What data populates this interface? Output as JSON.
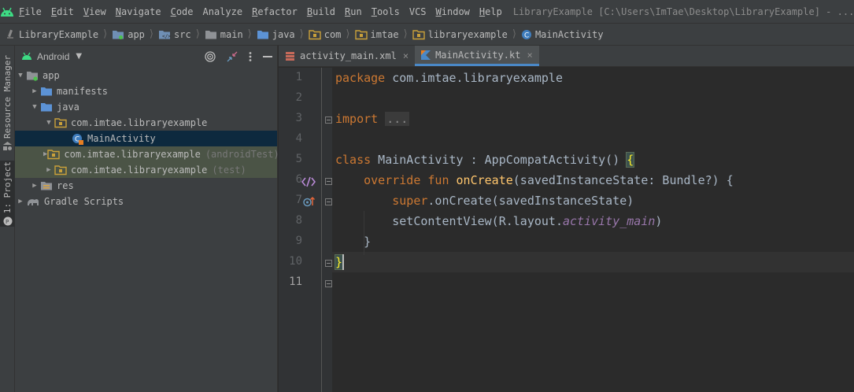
{
  "menubar": {
    "items": [
      {
        "label": "File",
        "mnemonic": "F",
        "rest": "ile"
      },
      {
        "label": "Edit",
        "mnemonic": "E",
        "rest": "dit"
      },
      {
        "label": "View",
        "mnemonic": "V",
        "rest": "iew"
      },
      {
        "label": "Navigate",
        "mnemonic": "N",
        "rest": "avigate"
      },
      {
        "label": "Code",
        "mnemonic": "C",
        "rest": "ode"
      },
      {
        "label": "Analyze",
        "mnemonic": "",
        "rest": "Analyze"
      },
      {
        "label": "Refactor",
        "mnemonic": "R",
        "rest": "efactor"
      },
      {
        "label": "Build",
        "mnemonic": "B",
        "rest": "uild"
      },
      {
        "label": "Run",
        "mnemonic": "R",
        "rest": "un"
      },
      {
        "label": "Tools",
        "mnemonic": "T",
        "rest": "ools"
      },
      {
        "label": "VCS",
        "mnemonic": "",
        "rest": "VCS"
      },
      {
        "label": "Window",
        "mnemonic": "W",
        "rest": "indow"
      },
      {
        "label": "Help",
        "mnemonic": "H",
        "rest": "elp"
      }
    ],
    "window_title": "LibraryExample [C:\\Users\\ImTae\\Desktop\\LibraryExample] - ...\\app\\src\\main\\java\\com\\"
  },
  "breadcrumb": [
    "LibraryExample",
    "app",
    "src",
    "main",
    "java",
    "com",
    "imtae",
    "libraryexample",
    "MainActivity"
  ],
  "left_strip": {
    "resource_manager": "Resource Manager",
    "project": "1: Project"
  },
  "project_panel": {
    "view_mode": "Android",
    "tree": [
      {
        "label": "app",
        "suffix": ""
      },
      {
        "label": "manifests",
        "suffix": ""
      },
      {
        "label": "java",
        "suffix": ""
      },
      {
        "label": "com.imtae.libraryexample",
        "suffix": ""
      },
      {
        "label": "MainActivity",
        "suffix": ""
      },
      {
        "label": "com.imtae.libraryexample",
        "suffix": "(androidTest)"
      },
      {
        "label": "com.imtae.libraryexample",
        "suffix": "(test)"
      },
      {
        "label": "res",
        "suffix": ""
      },
      {
        "label": "Gradle Scripts",
        "suffix": ""
      }
    ]
  },
  "editor": {
    "tabs": [
      {
        "label": "activity_main.xml",
        "close": "×"
      },
      {
        "label": "MainActivity.kt",
        "close": "×"
      }
    ],
    "line_numbers": [
      "1",
      "2",
      "3",
      "4",
      "5",
      "6",
      "7",
      "8",
      "9",
      "10",
      "11"
    ],
    "code": {
      "l1_kw": "package",
      "l1_rest": " com.imtae.libraryexample",
      "l3_kw": "import",
      "l3_fold": "...",
      "l6_kw": "class",
      "l6_rest": " MainActivity : AppCompatActivity() ",
      "l6_brace": "{",
      "l7_kw": "override fun",
      "l7_fn": "onCreate",
      "l7_rest": "(savedInstanceState: Bundle?) {",
      "l8_kw": "super",
      "l8_rest": ".onCreate(savedInstanceState)",
      "l9_rest": "setContentView(R.layout.",
      "l9_it": "activity_main",
      "l9_end": ")",
      "l10": "}",
      "l11": "}"
    }
  },
  "colors": {
    "keyword": "#cc7832",
    "function": "#ffc66d",
    "field": "#9876aa",
    "text": "#a9b7c6",
    "selection": "#0d293e",
    "tab_accent": "#4a88c7"
  }
}
